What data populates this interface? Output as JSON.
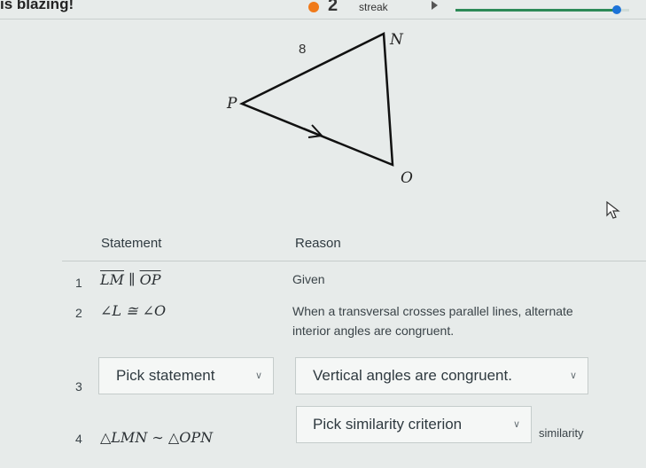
{
  "topbar": {
    "streak_message": "is blazing!",
    "streak_count": "2",
    "streak_label": "streak",
    "progress_fraction": 0.93,
    "colors": {
      "flame": "#f07a1a",
      "progress": "#2d8a57",
      "knob": "#1d73d8"
    }
  },
  "diagram": {
    "labels": {
      "n": "N",
      "p": "P",
      "o": "O",
      "side": "8"
    }
  },
  "proof": {
    "headers": {
      "statement": "Statement",
      "reason": "Reason"
    },
    "rows": [
      {
        "num": "1",
        "statement_a": "LM",
        "statement_rel": " ∥ ",
        "statement_b": "OP",
        "reason": "Given"
      },
      {
        "num": "2",
        "statement": "∠L ≅ ∠O",
        "reason_line1": "When a transversal crosses parallel lines, alternate",
        "reason_line2": "interior angles are congruent."
      },
      {
        "num": "3",
        "statement_dropdown": "Pick statement",
        "reason_dropdown": "Vertical angles are congruent."
      },
      {
        "num": "4",
        "statement": "△LMN ∼ △OPN",
        "reason_dropdown": "Pick similarity criterion",
        "reason_suffix": "similarity"
      }
    ]
  }
}
